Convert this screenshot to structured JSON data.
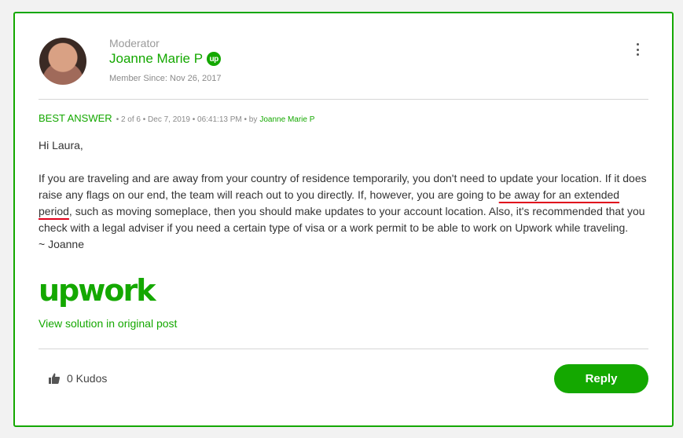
{
  "post": {
    "author_role": "Moderator",
    "author_name": "Joanne Marie P",
    "badge_text": "up",
    "member_since": "Member Since: Nov 26, 2017",
    "best_answer_label": "BEST ANSWER",
    "meta_text": "• 2 of 6 • Dec 7, 2019 • 06:41:13 PM • by",
    "meta_by": "Joanne Marie P",
    "greeting": "Hi Laura,",
    "para_part1": "If you are traveling and are away from your country of residence temporarily,  you don't need to update your location. If it does raise any flags on our end, the team will reach out to you directly.  If, however, you are going to ",
    "para_underlined": "be away for an extended period",
    "para_part2": ", such as moving someplace, then you should make updates to your account location. Also, it's recommended that you check with a legal adviser if you need a certain type of visa or a work permit to be able to work on Upwork while traveling.",
    "signoff": "~ Joanne",
    "logo_text": "upwork",
    "view_solution": "View solution in original post"
  },
  "footer": {
    "kudos_label": "0 Kudos",
    "reply_label": "Reply"
  },
  "icons": {
    "thumb": "thumbs-up-icon",
    "menu": "more-vertical-icon"
  },
  "colors": {
    "accent": "#14a800",
    "underline": "#e0001b"
  }
}
